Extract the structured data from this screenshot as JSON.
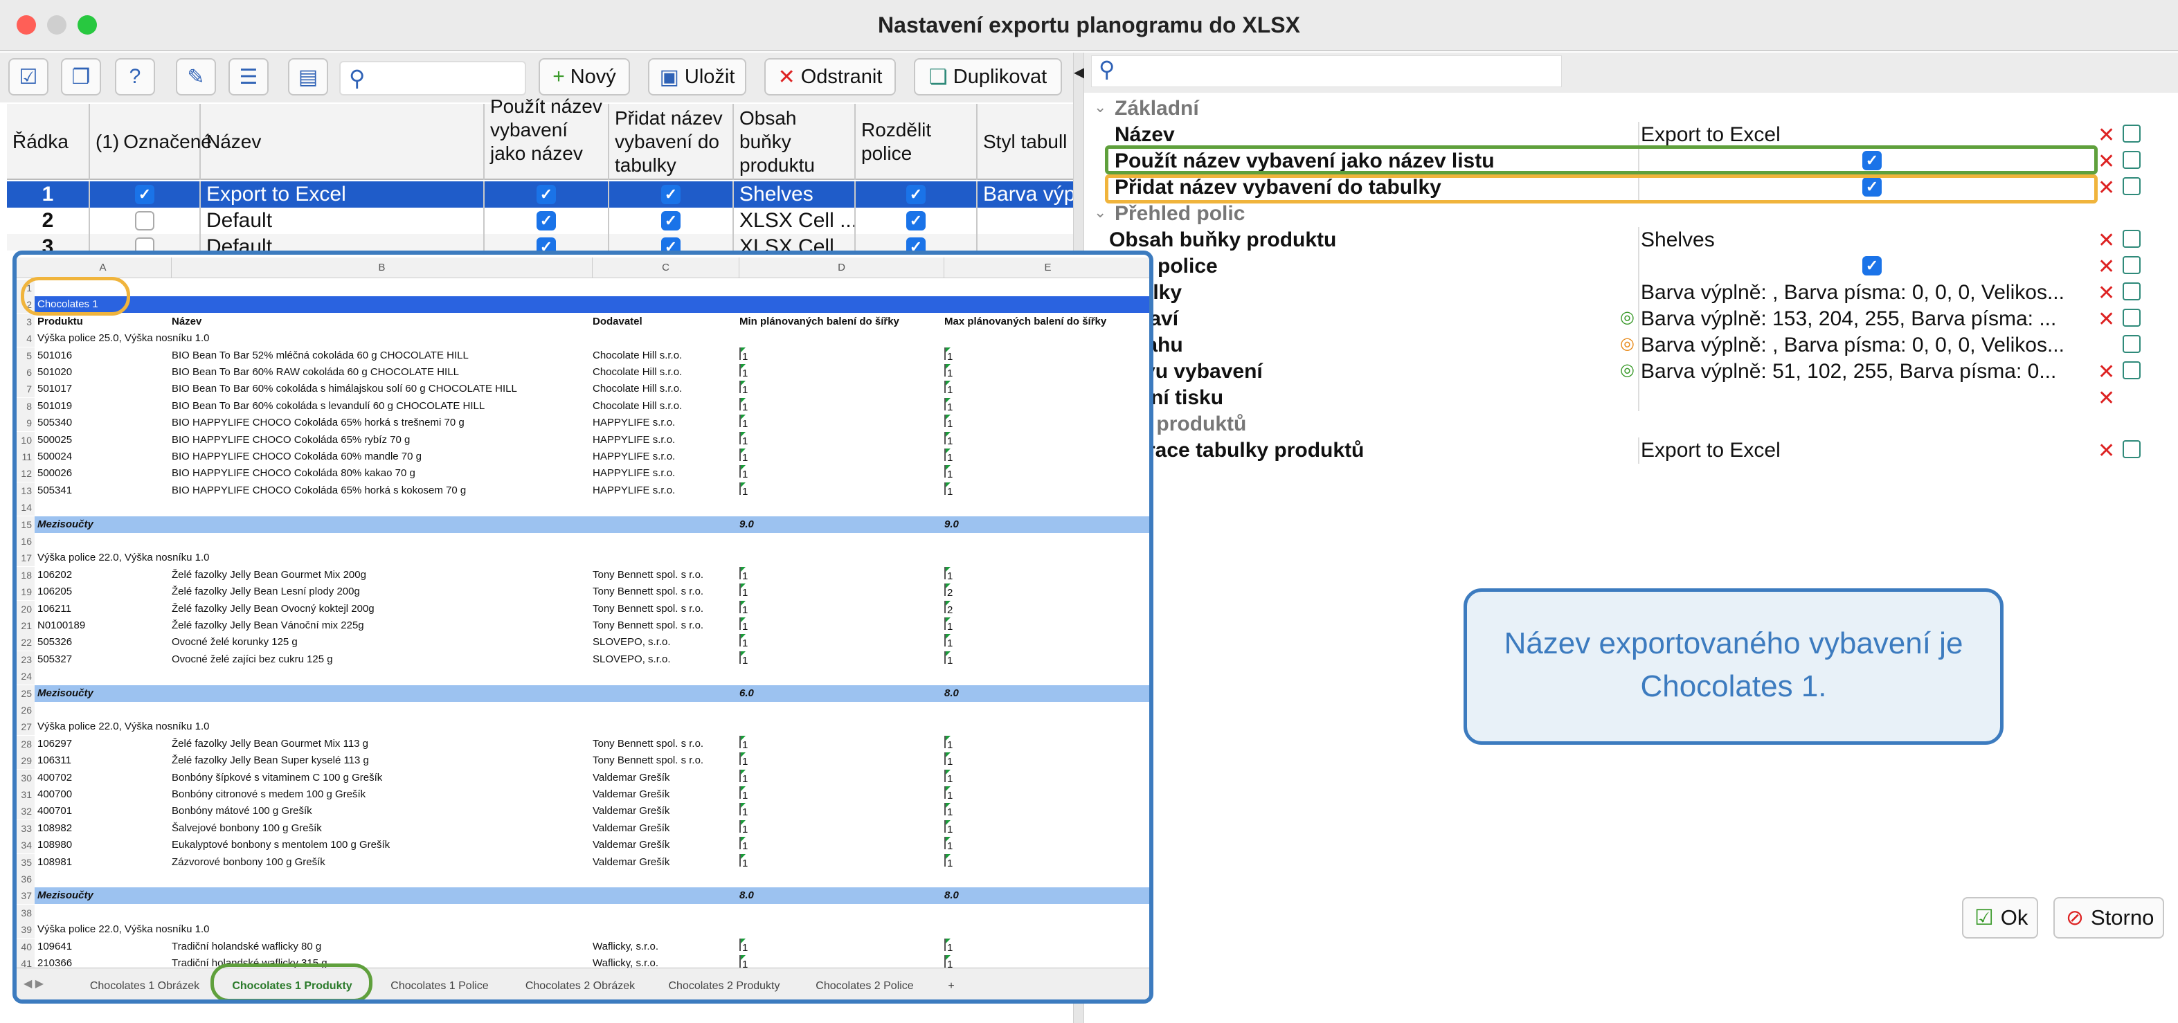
{
  "window": {
    "title": "Nastavení exportu planogramu do XLSX"
  },
  "toolbar": {
    "new_label": "Nový",
    "save_label": "Uložit",
    "delete_label": "Odstranit",
    "duplicate_label": "Duplikovat"
  },
  "grid": {
    "headers": [
      "Řádka",
      "Označené",
      "Název",
      "Použít název vybavení jako název ...",
      "Přidat název vybavení do tabulky",
      "Obsah buňky produktu",
      "Rozdělit police",
      "Styl tabull"
    ],
    "marked_header_prefix": "(1)",
    "rows": [
      {
        "num": "1",
        "name": "Export to Excel",
        "content": "Shelves",
        "style": "Barva výpl",
        "marked": true
      },
      {
        "num": "2",
        "name": "Default",
        "content": "XLSX Cell ...",
        "style": "",
        "marked": false
      },
      {
        "num": "3",
        "name": "Default",
        "content": "XLSX Cell ...",
        "style": "",
        "marked": false
      }
    ]
  },
  "excel": {
    "cols": [
      "A",
      "B",
      "C",
      "D",
      "E"
    ],
    "rows": [
      {
        "n": "1",
        "type": "blank"
      },
      {
        "n": "2",
        "type": "title",
        "a": "Chocolates 1"
      },
      {
        "n": "3",
        "type": "head",
        "a": "Produktu",
        "b": "Název",
        "c": "Dodavatel",
        "d": "Min plánovaných balení do šířky",
        "e": "Max plánovaných balení do šířky"
      },
      {
        "n": "4",
        "type": "label",
        "a": "Výška police 25.0, Výška nosníku 1.0"
      },
      {
        "n": "5",
        "type": "item",
        "a": "501016",
        "b": "BIO Bean To Bar 52% mléčná cokoláda 60 g CHOCOLATE HILL",
        "c": "Chocolate Hill s.r.o.",
        "d": "1",
        "e": "1"
      },
      {
        "n": "6",
        "type": "item",
        "a": "501020",
        "b": "BIO Bean To Bar 60% RAW cokoláda 60 g CHOCOLATE HILL",
        "c": "Chocolate Hill s.r.o.",
        "d": "1",
        "e": "1"
      },
      {
        "n": "7",
        "type": "item",
        "a": "501017",
        "b": "BIO Bean To Bar 60% cokoláda s himálajskou solí 60 g CHOCOLATE HILL",
        "c": "Chocolate Hill s.r.o.",
        "d": "1",
        "e": "1"
      },
      {
        "n": "8",
        "type": "item",
        "a": "501019",
        "b": "BIO Bean To Bar 60% cokoláda s levandulí 60 g CHOCOLATE HILL",
        "c": "Chocolate Hill s.r.o.",
        "d": "1",
        "e": "1"
      },
      {
        "n": "9",
        "type": "item",
        "a": "505340",
        "b": "BIO HAPPYLIFE CHOCO Cokoláda 65% horká s trešnemi 70 g",
        "c": "HAPPYLIFE s.r.o.",
        "d": "1",
        "e": "1"
      },
      {
        "n": "10",
        "type": "item",
        "a": "500025",
        "b": "BIO HAPPYLIFE CHOCO Cokoláda 65% rybíz 70 g",
        "c": "HAPPYLIFE s.r.o.",
        "d": "1",
        "e": "1"
      },
      {
        "n": "11",
        "type": "item",
        "a": "500024",
        "b": "BIO HAPPYLIFE CHOCO Cokoláda 60% mandle 70 g",
        "c": "HAPPYLIFE s.r.o.",
        "d": "1",
        "e": "1"
      },
      {
        "n": "12",
        "type": "item",
        "a": "500026",
        "b": "BIO HAPPYLIFE CHOCO Cokoláda 80% kakao 70 g",
        "c": "HAPPYLIFE s.r.o.",
        "d": "1",
        "e": "1"
      },
      {
        "n": "13",
        "type": "item",
        "a": "505341",
        "b": "BIO HAPPYLIFE CHOCO Cokoláda 65% horká s kokosem 70 g",
        "c": "HAPPYLIFE s.r.o.",
        "d": "1",
        "e": "1"
      },
      {
        "n": "14",
        "type": "blank"
      },
      {
        "n": "15",
        "type": "sub",
        "a": "Mezisoučty",
        "d": "9.0",
        "e": "9.0"
      },
      {
        "n": "16",
        "type": "blank"
      },
      {
        "n": "17",
        "type": "label",
        "a": "Výška police 22.0, Výška nosníku 1.0"
      },
      {
        "n": "18",
        "type": "item",
        "a": "106202",
        "b": "Želé fazolky Jelly Bean Gourmet Mix 200g",
        "c": "Tony Bennett spol. s r.o.",
        "d": "1",
        "e": "1"
      },
      {
        "n": "19",
        "type": "item",
        "a": "106205",
        "b": "Želé fazolky Jelly Bean Lesní plody 200g",
        "c": "Tony Bennett spol. s r.o.",
        "d": "1",
        "e": "2"
      },
      {
        "n": "20",
        "type": "item",
        "a": "106211",
        "b": "Želé fazolky Jelly Bean Ovocný koktejl 200g",
        "c": "Tony Bennett spol. s r.o.",
        "d": "1",
        "e": "2"
      },
      {
        "n": "21",
        "type": "item",
        "a": "N0100189",
        "b": "Želé fazolky Jelly Bean Vánoční mix 225g",
        "c": "Tony Bennett spol. s r.o.",
        "d": "1",
        "e": "1"
      },
      {
        "n": "22",
        "type": "item",
        "a": "505326",
        "b": "Ovocné želé korunky 125 g",
        "c": "SLOVEPO, s.r.o.",
        "d": "1",
        "e": "1"
      },
      {
        "n": "23",
        "type": "item",
        "a": "505327",
        "b": "Ovocné želé zajíci bez cukru 125 g",
        "c": "SLOVEPO, s.r.o.",
        "d": "1",
        "e": "1"
      },
      {
        "n": "24",
        "type": "blank"
      },
      {
        "n": "25",
        "type": "sub",
        "a": "Mezisoučty",
        "d": "6.0",
        "e": "8.0"
      },
      {
        "n": "26",
        "type": "blank"
      },
      {
        "n": "27",
        "type": "label",
        "a": "Výška police 22.0, Výška nosníku 1.0"
      },
      {
        "n": "28",
        "type": "item",
        "a": "106297",
        "b": "Želé fazolky Jelly Bean Gourmet Mix 113 g",
        "c": "Tony Bennett spol. s r.o.",
        "d": "1",
        "e": "1"
      },
      {
        "n": "29",
        "type": "item",
        "a": "106311",
        "b": "Želé fazolky Jelly Bean Super kyselé 113 g",
        "c": "Tony Bennett spol. s r.o.",
        "d": "1",
        "e": "1"
      },
      {
        "n": "30",
        "type": "item",
        "a": "400702",
        "b": "Bonbóny šípkové s vitaminem C 100 g Grešík",
        "c": "Valdemar Grešík",
        "d": "1",
        "e": "1"
      },
      {
        "n": "31",
        "type": "item",
        "a": "400700",
        "b": "Bonbóny citronové s medem 100 g Grešík",
        "c": "Valdemar Grešík",
        "d": "1",
        "e": "1"
      },
      {
        "n": "32",
        "type": "item",
        "a": "400701",
        "b": "Bonbóny mátové 100 g Grešík",
        "c": "Valdemar Grešík",
        "d": "1",
        "e": "1"
      },
      {
        "n": "33",
        "type": "item",
        "a": "108982",
        "b": "Šalvejové bonbony 100 g Grešík",
        "c": "Valdemar Grešík",
        "d": "1",
        "e": "1"
      },
      {
        "n": "34",
        "type": "item",
        "a": "108980",
        "b": "Eukalyptové bonbony s mentolem 100 g Grešík",
        "c": "Valdemar Grešík",
        "d": "1",
        "e": "1"
      },
      {
        "n": "35",
        "type": "item",
        "a": "108981",
        "b": "Zázvorové bonbony 100 g Grešík",
        "c": "Valdemar Grešík",
        "d": "1",
        "e": "1"
      },
      {
        "n": "36",
        "type": "blank"
      },
      {
        "n": "37",
        "type": "sub",
        "a": "Mezisoučty",
        "d": "8.0",
        "e": "8.0"
      },
      {
        "n": "38",
        "type": "blank"
      },
      {
        "n": "39",
        "type": "label",
        "a": "Výška police 22.0, Výška nosníku 1.0"
      },
      {
        "n": "40",
        "type": "item",
        "a": "109641",
        "b": "Tradiční holandské waflicky 80 g",
        "c": "Waflicky, s.r.o.",
        "d": "1",
        "e": "1"
      },
      {
        "n": "41",
        "type": "item",
        "a": "210366",
        "b": "Tradiční holandské waflicky 315 g",
        "c": "Waflicky, s.r.o.",
        "d": "1",
        "e": "1"
      }
    ],
    "sheet_tabs": [
      "Chocolates 1 Obrázek",
      "Chocolates 1 Produkty",
      "Chocolates 1 Police",
      "Chocolates 2 Obrázek",
      "Chocolates 2 Produkty",
      "Chocolates 2 Police"
    ],
    "add_tab": "+"
  },
  "props": {
    "sections": {
      "basic": "Základní",
      "shelves": "Přehled polic",
      "product_table": "ulka produktů"
    },
    "name_label": "Název",
    "name_value": "Export to Excel",
    "use_name_label": "Použít název vybavení jako název listu",
    "add_name_label": "Přidat název vybavení do tabulky",
    "cell_content_label": "Obsah buňky produktu",
    "cell_content_value": "Shelves",
    "split_label": "dělit police",
    "table_label": "tabulky",
    "table_value": "Barva výplně: , Barva písma: 0, 0, 0, Velikos...",
    "header_label": "záhlaví",
    "header_value": "Barva výplně: 153, 204, 255, Barva písma: ...",
    "content_label": "obsahu",
    "content_value": "Barva výplně: , Barva písma: 0, 0, 0, Velikos...",
    "equip_name_label": "názvu vybavení",
    "equip_name_value": "Barva výplně: 51, 102, 255, Barva písma: 0...",
    "print_label": "tavení tisku",
    "config_label": "figurace tabulky produktů",
    "config_value": "Export to Excel"
  },
  "callout": {
    "text": "Název exportovaného vybavení je Chocolates 1."
  },
  "footer": {
    "ok_label": "Ok",
    "cancel_label": "Storno"
  }
}
